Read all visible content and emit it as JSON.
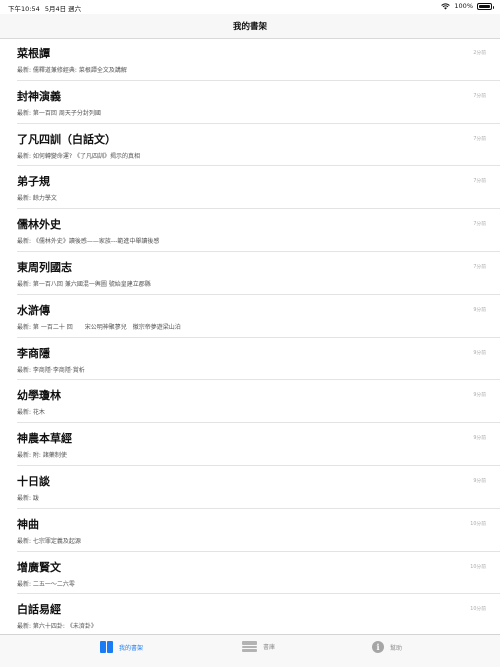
{
  "statusbar": {
    "time": "下午10:54",
    "date": "5月4日 週六",
    "battery": "100%"
  },
  "navbar": {
    "title": "我的書架"
  },
  "books": [
    {
      "title": "菜根譚",
      "latest": "最新:  儒釋道兼修經典: 菜根譚全文及講解",
      "time": "2分前"
    },
    {
      "title": "封神演義",
      "latest": "最新:  第一百回 周天子分封列國",
      "time": "7分前"
    },
    {
      "title": "了凡四訓（白話文）",
      "latest": "最新:  如何轉變命運? 《了凡四訓》揭示的真相",
      "time": "7分前"
    },
    {
      "title": "弟子規",
      "latest": "最新:  餘力學文",
      "time": "7分前"
    },
    {
      "title": "儒林外史",
      "latest": "最新:  《儒林外史》讀後感——家族---範進中舉讀後感",
      "time": "7分前"
    },
    {
      "title": "東周列國志",
      "latest": "最新:  第一百八回 兼六國混一輿圖 號始皇建立郡縣",
      "time": "7分前"
    },
    {
      "title": "水滸傳",
      "latest": "最新:  第 一百二十 回　　宋公明神聚蓼兒　徽宗帝夢遊梁山泊",
      "time": "9分前"
    },
    {
      "title": "李商隱",
      "latest": "最新:  李商隱·李商隱·賞析",
      "time": "9分前"
    },
    {
      "title": "幼學瓊林",
      "latest": "最新:  花木",
      "time": "9分前"
    },
    {
      "title": "神農本草經",
      "latest": "最新:  附: 諸藥制使",
      "time": "9分前"
    },
    {
      "title": "十日談",
      "latest": "最新:  跋",
      "time": "9分前"
    },
    {
      "title": "神曲",
      "latest": "最新:  七宗罪定義及起源",
      "time": "10分前"
    },
    {
      "title": "增廣賢文",
      "latest": "最新:  二五一～二六零",
      "time": "10分前"
    },
    {
      "title": "白話易經",
      "latest": "最新:  第六十四卦: 《未濟卦》",
      "time": "10分前"
    }
  ],
  "tabbar": {
    "tabs": [
      {
        "label": "我的書架",
        "icon": "books-icon",
        "active": true
      },
      {
        "label": "書庫",
        "icon": "bookshelf-icon",
        "active": false
      },
      {
        "label": "幫助",
        "icon": "help-icon",
        "active": false
      }
    ],
    "accent": "#1a7cf5",
    "inactive": "#8e8e8e"
  }
}
